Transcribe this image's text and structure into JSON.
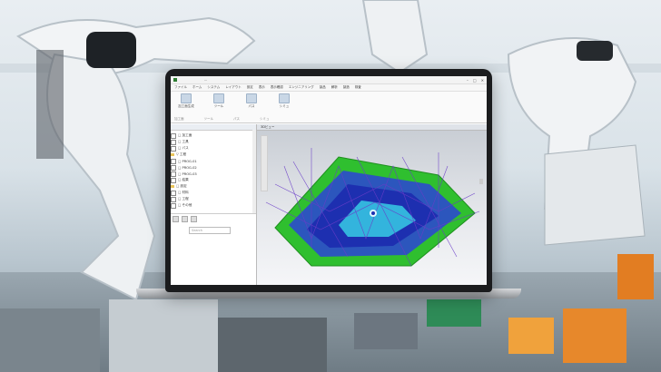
{
  "window": {
    "title": "...",
    "controls": [
      "–",
      "□",
      "✕"
    ]
  },
  "menubar": [
    "ファイル",
    "ホーム",
    "システム",
    "レイアウト",
    "設定",
    "表示",
    "表示確認",
    "エンジニアリング",
    "製品",
    "解析",
    "製造",
    "検査"
  ],
  "ribbon": {
    "buttons": [
      {
        "label": "加工面生成",
        "icon": "surface-icon"
      },
      {
        "label": "ツール",
        "icon": "tool-icon"
      },
      {
        "label": "パス",
        "icon": "path-icon"
      },
      {
        "label": "シミュ",
        "icon": "sim-icon"
      }
    ],
    "groups": [
      "加工面",
      "ツール",
      "パス",
      "シミュ"
    ]
  },
  "tree": {
    "items": [
      {
        "label": "□ 加工面",
        "type": "box"
      },
      {
        "label": "□ 工具",
        "type": "box"
      },
      {
        "label": "□ パス",
        "type": "box"
      },
      {
        "label": "▽ 工程",
        "type": "folder"
      },
      {
        "label": "  □ PROG-01",
        "type": "box"
      },
      {
        "label": "  □ PROG-02",
        "type": "box"
      },
      {
        "label": "  □ PROG-03",
        "type": "box"
      },
      {
        "label": "  □ 結果",
        "type": "box"
      },
      {
        "label": "□ 設定",
        "type": "folder"
      },
      {
        "label": "□ 材料",
        "type": "box"
      },
      {
        "label": "□ 工程",
        "type": "box"
      },
      {
        "label": "□ その他",
        "type": "box"
      }
    ],
    "search_placeholder": "Search"
  },
  "viewport": {
    "tab_label": "3Dビュー"
  },
  "colors": {
    "model_blue": "#2b43d6",
    "model_green": "#2fbf2f",
    "model_cyan": "#3ad6e8",
    "path_purple": "#6a3cc8"
  }
}
